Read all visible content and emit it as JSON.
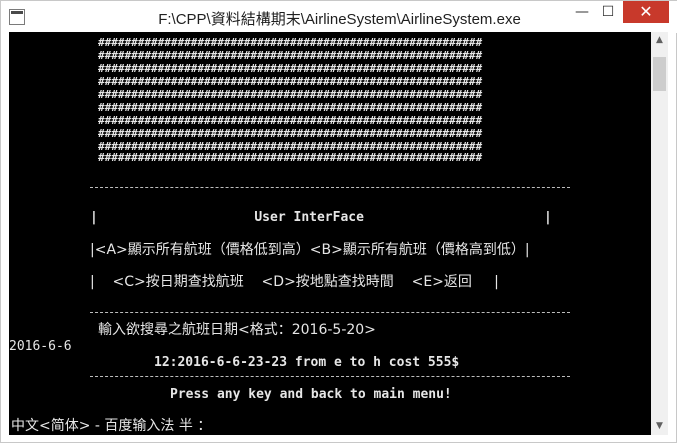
{
  "window": {
    "title": "F:\\CPP\\資料結構期末\\AirlineSystem\\AirlineSystem.exe",
    "controls": {
      "minimize": "—",
      "maximize": "☐",
      "close": "✕"
    }
  },
  "console": {
    "hash_rows": [
      "##########################################################",
      "##########################################################",
      "##########################################################",
      "##########################################################",
      "##########################################################",
      "##########################################################",
      "##########################################################",
      "##########################################################",
      "##########################################################",
      "##########################################################"
    ],
    "menu": {
      "title_line": "|                    User InterFace                       |",
      "option_line_1": "|<A>顯示所有航班（價格低到高）<B>顯示所有航班（價格高到低）|",
      "option_line_2": "|    <C>按日期查找航班    <D>按地點查找時間    <E>返回     |"
    },
    "prompt": "輸入欲搜尋之航班日期<格式：2016-5-20>",
    "input_value": "2016-6-6",
    "result": "12:2016-6-6-23-23 from e to h cost 555$",
    "footer_message": "Press any key and back to main menu!",
    "ime_status": "中文<简体> - 百度输入法 半 ："
  },
  "scrollbar": {
    "up": "▲",
    "down": "▼"
  }
}
